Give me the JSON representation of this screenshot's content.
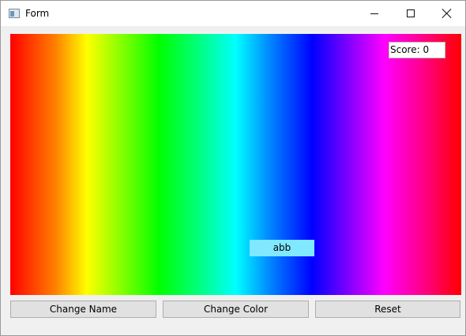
{
  "window": {
    "title": "Form",
    "controls": {
      "minimize_icon": "minimize-icon",
      "maximize_icon": "maximize-icon",
      "close_icon": "close-icon"
    }
  },
  "game": {
    "score_label": "Score: 0",
    "player_name": "abb",
    "player_color": "#80e8ff",
    "background": "rainbow-gradient"
  },
  "buttons": {
    "change_name": "Change Name",
    "change_color": "Change Color",
    "reset": "Reset"
  }
}
